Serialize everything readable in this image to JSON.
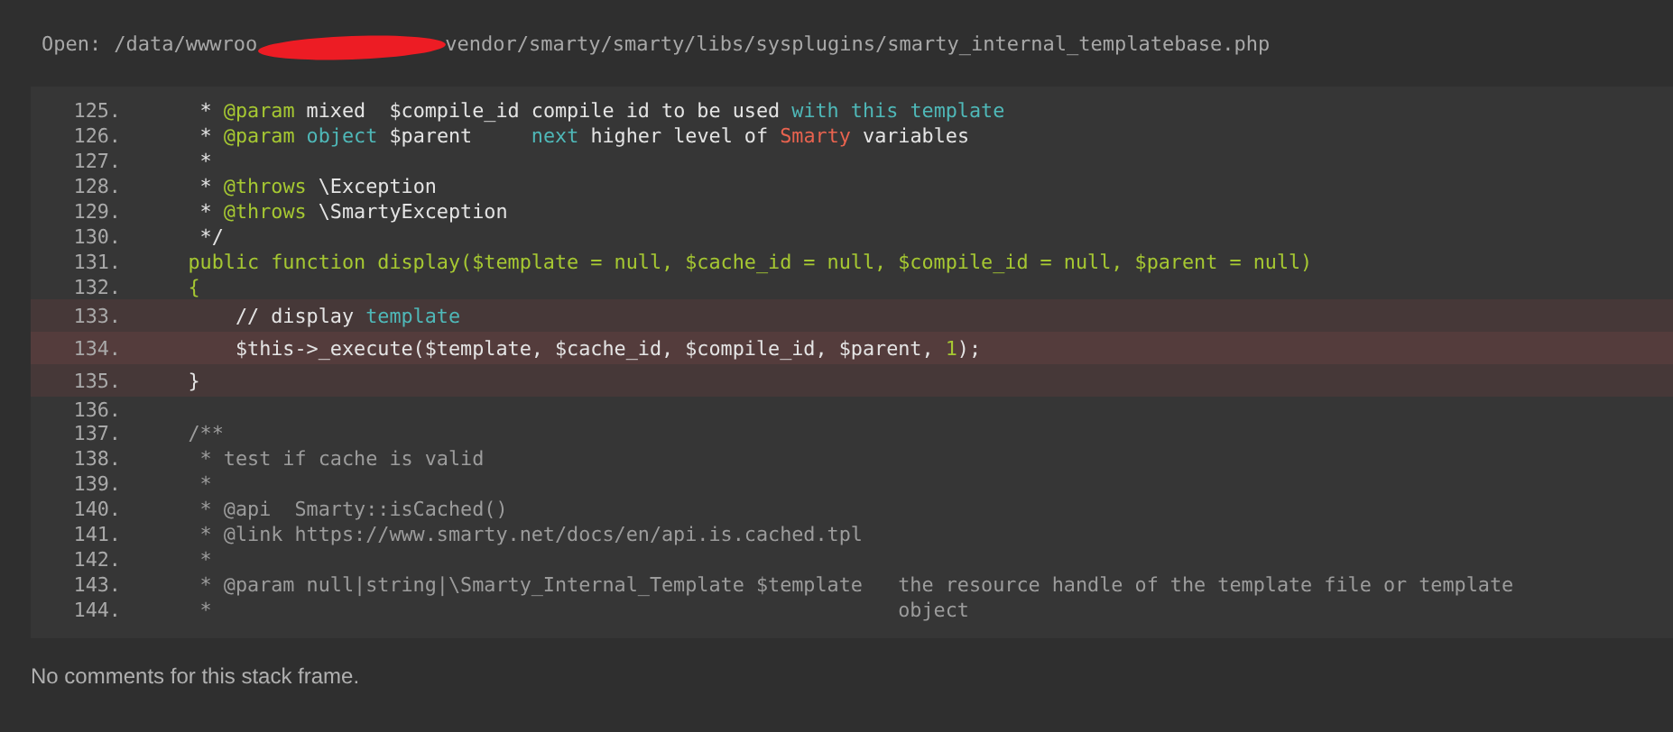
{
  "file_header": {
    "label": "Open:",
    "path_start": "/data/wwwroo",
    "redacted": true,
    "path_end": "vendor/smarty/smarty/libs/sysplugins/smarty_internal_templatebase.php"
  },
  "code": {
    "lines": [
      {
        "number": "125.",
        "highlighted": false,
        "error_line": false,
        "tokens": [
          {
            "kind": "plain",
            "text": "     * "
          },
          {
            "kind": "tag",
            "text": "@param"
          },
          {
            "kind": "plain",
            "text": " mixed  $compile_id compile id to be used "
          },
          {
            "kind": "type",
            "text": "with this template"
          }
        ]
      },
      {
        "number": "126.",
        "highlighted": false,
        "error_line": false,
        "tokens": [
          {
            "kind": "plain",
            "text": "     * "
          },
          {
            "kind": "tag",
            "text": "@param"
          },
          {
            "kind": "type",
            "text": " object"
          },
          {
            "kind": "plain",
            "text": " $parent     "
          },
          {
            "kind": "type",
            "text": "next"
          },
          {
            "kind": "plain",
            "text": " higher level of "
          },
          {
            "kind": "name",
            "text": "Smarty"
          },
          {
            "kind": "plain",
            "text": " variables"
          }
        ]
      },
      {
        "number": "127.",
        "highlighted": false,
        "error_line": false,
        "tokens": [
          {
            "kind": "plain",
            "text": "     *"
          }
        ]
      },
      {
        "number": "128.",
        "highlighted": false,
        "error_line": false,
        "tokens": [
          {
            "kind": "plain",
            "text": "     * "
          },
          {
            "kind": "tag",
            "text": "@throws"
          },
          {
            "kind": "plain",
            "text": " \\Exception"
          }
        ]
      },
      {
        "number": "129.",
        "highlighted": false,
        "error_line": false,
        "tokens": [
          {
            "kind": "plain",
            "text": "     * "
          },
          {
            "kind": "tag",
            "text": "@throws"
          },
          {
            "kind": "plain",
            "text": " \\SmartyException"
          }
        ]
      },
      {
        "number": "130.",
        "highlighted": false,
        "error_line": false,
        "tokens": [
          {
            "kind": "plain",
            "text": "     */"
          }
        ]
      },
      {
        "number": "131.",
        "highlighted": false,
        "error_line": false,
        "tokens": [
          {
            "kind": "code",
            "text": "    public function display($template = null, $cache_id = null, $compile_id = null, $parent = null)"
          }
        ]
      },
      {
        "number": "132.",
        "highlighted": false,
        "error_line": false,
        "tokens": [
          {
            "kind": "code",
            "text": "    {"
          }
        ]
      },
      {
        "number": "133.",
        "highlighted": true,
        "error_line": false,
        "tokens": [
          {
            "kind": "plain",
            "text": "        // display "
          },
          {
            "kind": "type",
            "text": "template"
          }
        ]
      },
      {
        "number": "134.",
        "highlighted": true,
        "error_line": true,
        "tokens": [
          {
            "kind": "plain",
            "text": "        $this->_execute($template, $cache_id, $compile_id, $parent, "
          },
          {
            "kind": "code",
            "text": "1"
          },
          {
            "kind": "plain",
            "text": ");"
          }
        ]
      },
      {
        "number": "135.",
        "highlighted": true,
        "error_line": false,
        "tokens": [
          {
            "kind": "plain",
            "text": "    }"
          }
        ]
      },
      {
        "number": "136.",
        "highlighted": false,
        "error_line": false
      },
      {
        "number": "137.",
        "highlighted": false,
        "error_line": false,
        "tokens": [
          {
            "kind": "comment",
            "text": "    /**"
          }
        ]
      },
      {
        "number": "138.",
        "highlighted": false,
        "error_line": false,
        "tokens": [
          {
            "kind": "comment",
            "text": "     * test if cache is valid"
          }
        ]
      },
      {
        "number": "139.",
        "highlighted": false,
        "error_line": false,
        "tokens": [
          {
            "kind": "comment",
            "text": "     *"
          }
        ]
      },
      {
        "number": "140.",
        "highlighted": false,
        "error_line": false,
        "tokens": [
          {
            "kind": "comment",
            "text": "     * @api  Smarty::isCached()"
          }
        ]
      },
      {
        "number": "141.",
        "highlighted": false,
        "error_line": false,
        "tokens": [
          {
            "kind": "comment",
            "text": "     * @link https://www.smarty.net/docs/en/api.is.cached.tpl"
          }
        ]
      },
      {
        "number": "142.",
        "highlighted": false,
        "error_line": false,
        "tokens": [
          {
            "kind": "comment",
            "text": "     *"
          }
        ]
      },
      {
        "number": "143.",
        "highlighted": false,
        "error_line": false,
        "tokens": [
          {
            "kind": "comment",
            "text": "     * @param null|string|\\Smarty_Internal_Template $template   the resource handle of the template file or template"
          }
        ]
      },
      {
        "number": "144.",
        "highlighted": false,
        "error_line": false,
        "tokens": [
          {
            "kind": "comment",
            "text": "     *                                                          object"
          }
        ]
      }
    ]
  },
  "comments_note": "No comments for this stack frame."
}
